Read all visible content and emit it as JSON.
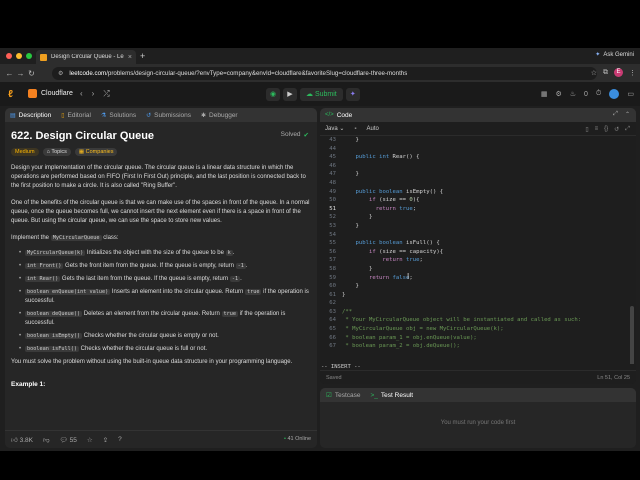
{
  "browser": {
    "tab_title": "Design Circular Queue - Leet",
    "ask_gemini": "Ask Gemini",
    "url_host": "leetcode.com",
    "url_path": "/problems/design-circular-queue/?envType=company&envId=cloudflare&favoriteSlug=cloudflare-three-months",
    "avatar_letter": "E"
  },
  "header": {
    "company": "Cloudflare",
    "submit_label": "Submit",
    "streak_count": "0"
  },
  "left_tabs": [
    {
      "label": "Description",
      "icon": "document-icon"
    },
    {
      "label": "Editorial",
      "icon": "book-icon"
    },
    {
      "label": "Solutions",
      "icon": "flask-icon"
    },
    {
      "label": "Submissions",
      "icon": "history-icon"
    },
    {
      "label": "Debugger",
      "icon": "bug-icon"
    }
  ],
  "problem": {
    "title": "622. Design Circular Queue",
    "status": "Solved",
    "chips": {
      "difficulty": "Medium",
      "topics": "Topics",
      "companies": "Companies"
    },
    "para1": "Design your implementation of the circular queue. The circular queue is a linear data structure in which the operations are performed based on FIFO (First In First Out) principle, and the last position is connected back to the first position to make a circle. It is also called \"Ring Buffer\".",
    "para2": "One of the benefits of the circular queue is that we can make use of the spaces in front of the queue. In a normal queue, once the queue becomes full, we cannot insert the next element even if there is a space in front of the queue. But using the circular queue, we can use the space to store new values.",
    "impl_prefix": "Implement the",
    "impl_code": "MyCircularQueue",
    "impl_suffix": "class:",
    "bullets": [
      {
        "code": "MyCircularQueue(k)",
        "text": " Initializes the object with the size of the queue to be ",
        "code2": "k",
        "tail": "."
      },
      {
        "code": "int Front()",
        "text": " Gets the front item from the queue. If the queue is empty, return ",
        "code2": "-1",
        "tail": "."
      },
      {
        "code": "int Rear()",
        "text": " Gets the last item from the queue. If the queue is empty, return ",
        "code2": "-1",
        "tail": "."
      },
      {
        "code": "boolean enQueue(int value)",
        "text": " Inserts an element into the circular queue. Return ",
        "code2": "true",
        "tail": " if the operation is successful."
      },
      {
        "code": "boolean deQueue()",
        "text": " Deletes an element from the circular queue. Return ",
        "code2": "true",
        "tail": " if the operation is successful."
      },
      {
        "code": "boolean isEmpty()",
        "text": " Checks whether the circular queue is empty or not.",
        "code2": "",
        "tail": ""
      },
      {
        "code": "boolean isFull()",
        "text": " Checks whether the circular queue is full or not.",
        "code2": "",
        "tail": ""
      }
    ],
    "para3": "You must solve the problem without using the built-in queue data structure in your programming language.",
    "example_label": "Example 1:"
  },
  "left_footer": {
    "likes": "3.8K",
    "comments": "55",
    "online": "41 Online"
  },
  "code_panel": {
    "title": "Code",
    "language": "Java",
    "mode": "Auto",
    "lines": [
      {
        "n": "43",
        "t": "    }"
      },
      {
        "n": "44",
        "t": ""
      },
      {
        "n": "45",
        "t": "    public int Rear() {"
      },
      {
        "n": "46",
        "t": ""
      },
      {
        "n": "47",
        "t": "    }"
      },
      {
        "n": "48",
        "t": ""
      },
      {
        "n": "49",
        "t": "    public boolean isEmpty() {"
      },
      {
        "n": "50",
        "t": "        if (size == 0){"
      },
      {
        "n": "51",
        "t": "          return true;"
      },
      {
        "n": "52",
        "t": "        }"
      },
      {
        "n": "53",
        "t": "    }"
      },
      {
        "n": "54",
        "t": ""
      },
      {
        "n": "55",
        "t": "    public boolean isFull() {"
      },
      {
        "n": "56",
        "t": "        if (size == capacity){"
      },
      {
        "n": "57",
        "t": "            return true;"
      },
      {
        "n": "58",
        "t": "        }"
      },
      {
        "n": "59",
        "t": "        return false;"
      },
      {
        "n": "60",
        "t": "    }"
      },
      {
        "n": "61",
        "t": "}"
      },
      {
        "n": "62",
        "t": ""
      },
      {
        "n": "63",
        "t": "/**"
      },
      {
        "n": "64",
        "t": " * Your MyCircularQueue object will be instantiated and called as such:"
      },
      {
        "n": "65",
        "t": " * MyCircularQueue obj = new MyCircularQueue(k);"
      },
      {
        "n": "66",
        "t": " * boolean param_1 = obj.enQueue(value);"
      },
      {
        "n": "67",
        "t": " * boolean param_2 = obj.deQueue();"
      }
    ],
    "insert_mode": "-- INSERT --",
    "saved": "Saved",
    "cursor_pos": "Ln 51, Col 25"
  },
  "test_panel": {
    "tab_testcase": "Testcase",
    "tab_result": "Test Result",
    "message": "You must run your code first"
  }
}
